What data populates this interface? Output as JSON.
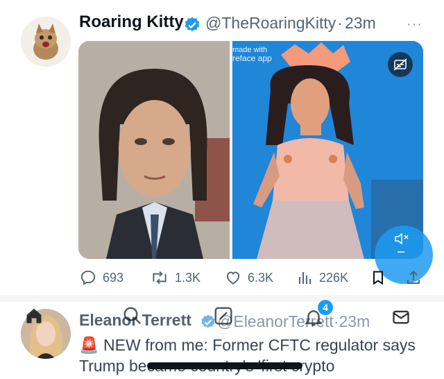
{
  "tweet1": {
    "name": "Roaring Kitty",
    "handle": "@TheRoaringKitty",
    "separator": "·",
    "time": "23m",
    "more": "···",
    "watermark_line1": "made with",
    "watermark_line2": "reface app",
    "stats": {
      "replies": "693",
      "retweets": "1.3K",
      "likes": "6.3K",
      "views": "226K"
    }
  },
  "tweet2": {
    "name": "Eleanor Terrett",
    "handle": "@EleanorTerrett",
    "separator": "·",
    "time": "23m",
    "body": "🚨 NEW from me: Former CFTC regulator says Trump became country's 'first crypto"
  },
  "bottom_nav": {
    "notifications_badge": "4"
  },
  "colors": {
    "accent": "#1d9bf0",
    "text": "#0f1419",
    "secondary": "#536471"
  }
}
